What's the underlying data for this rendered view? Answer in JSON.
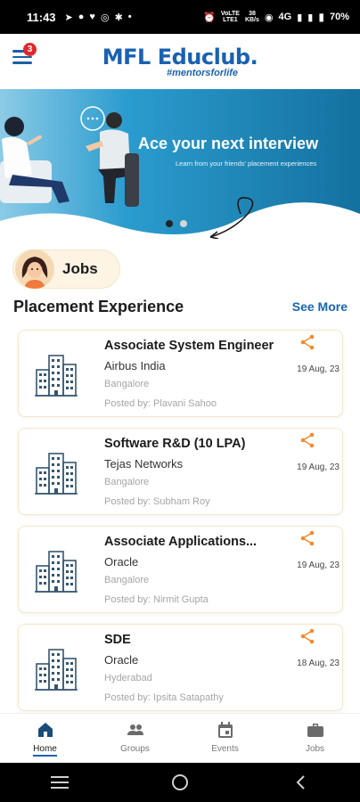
{
  "status_bar": {
    "time": "11:43",
    "network_top": "VoLTE",
    "network_bottom": "LTE1",
    "speed_top": "38",
    "speed_bottom": "KB/s",
    "signal_label": "4G",
    "battery": "70%"
  },
  "header": {
    "logo_name": "MFL Educlub.",
    "logo_tagline": "#mentorsforlife",
    "notification_count": "3"
  },
  "banner": {
    "title": "Ace your next interview",
    "subtitle": "Learn from your friends' placement experiences",
    "slides_total": 2,
    "slide_active": 1
  },
  "jobs_chip": {
    "label": "Jobs"
  },
  "section": {
    "title": "Placement Experience",
    "see_more": "See More"
  },
  "cards": [
    {
      "title": "Associate System Engineer",
      "company": "Airbus India",
      "location": "Bangalore",
      "posted_by": "Posted by: Plavani Sahoo",
      "date": "19 Aug, 23"
    },
    {
      "title": "Software R&D (10 LPA)",
      "company": "Tejas Networks",
      "location": "Bangalore",
      "posted_by": "Posted by: Subham Roy",
      "date": "19 Aug, 23"
    },
    {
      "title": "Associate Applications...",
      "company": "Oracle",
      "location": "Bangalore",
      "posted_by": "Posted by: Nirmit Gupta",
      "date": "19 Aug, 23"
    },
    {
      "title": "SDE",
      "company": "Oracle",
      "location": "Hyderabad",
      "posted_by": "Posted by: Ipsita Satapathy",
      "date": "18 Aug, 23"
    }
  ],
  "bottom_nav": [
    {
      "label": "Home",
      "icon": "home-icon",
      "active": true
    },
    {
      "label": "Groups",
      "icon": "groups-icon",
      "active": false
    },
    {
      "label": "Events",
      "icon": "calendar-icon",
      "active": false
    },
    {
      "label": "Jobs",
      "icon": "briefcase-icon",
      "active": false
    }
  ],
  "colors": {
    "brand_blue": "#1a61b1",
    "accent_orange": "#f28a2e",
    "banner_blue": "#1d8ec0",
    "card_border": "#f3e8c8"
  }
}
